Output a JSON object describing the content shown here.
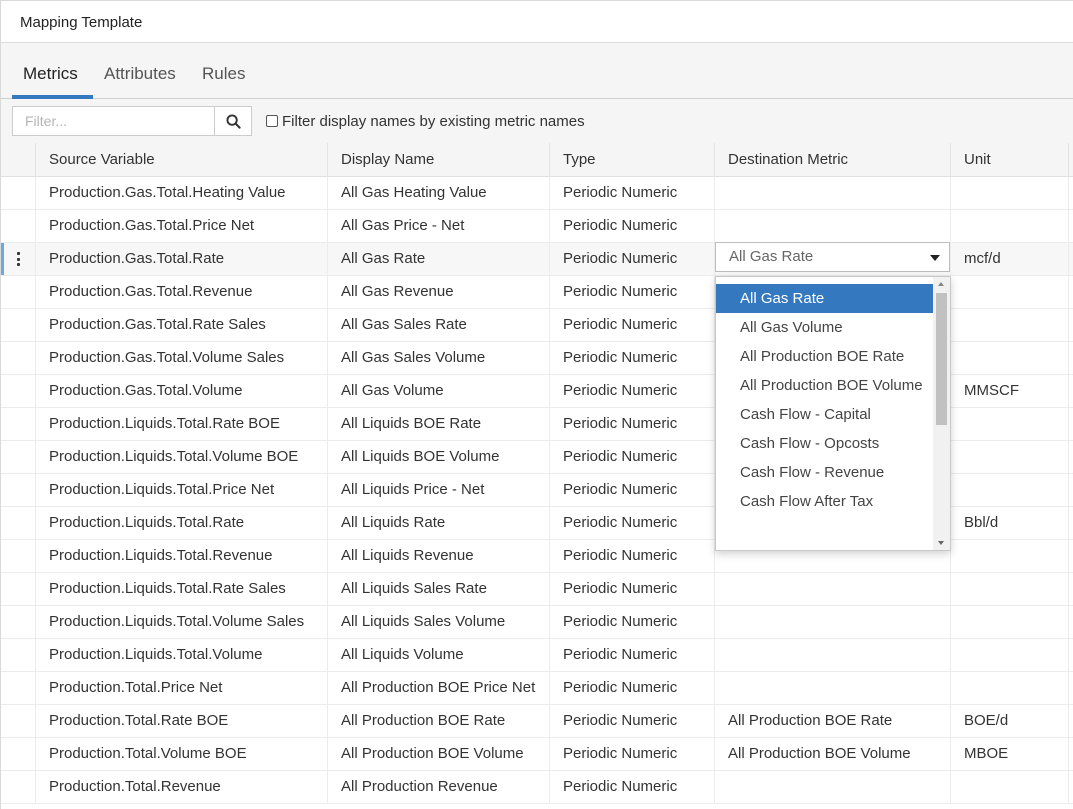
{
  "window": {
    "title": "Mapping Template"
  },
  "tabs": [
    {
      "label": "Metrics",
      "active": true
    },
    {
      "label": "Attributes",
      "active": false
    },
    {
      "label": "Rules",
      "active": false
    }
  ],
  "filter": {
    "placeholder": "Filter...",
    "value": "",
    "search_icon": "search-icon",
    "checkbox_label": "Filter display names by existing metric names",
    "checkbox_checked": false
  },
  "columns": [
    "Source Variable",
    "Display Name",
    "Type",
    "Destination Metric",
    "Unit"
  ],
  "rows": [
    {
      "source": "Production.Gas.Total.Heating Value",
      "display": "All Gas Heating Value",
      "type": "Periodic Numeric",
      "dest": "",
      "unit": ""
    },
    {
      "source": "Production.Gas.Total.Price Net",
      "display": "All Gas Price - Net",
      "type": "Periodic Numeric",
      "dest": "",
      "unit": ""
    },
    {
      "source": "Production.Gas.Total.Rate",
      "display": "All Gas Rate",
      "type": "Periodic Numeric",
      "dest": "All Gas Rate",
      "unit": "mcf/d",
      "selected": true
    },
    {
      "source": "Production.Gas.Total.Revenue",
      "display": "All Gas Revenue",
      "type": "Periodic Numeric",
      "dest": "",
      "unit": ""
    },
    {
      "source": "Production.Gas.Total.Rate Sales",
      "display": "All Gas Sales Rate",
      "type": "Periodic Numeric",
      "dest": "",
      "unit": ""
    },
    {
      "source": "Production.Gas.Total.Volume Sales",
      "display": "All Gas Sales Volume",
      "type": "Periodic Numeric",
      "dest": "",
      "unit": ""
    },
    {
      "source": "Production.Gas.Total.Volume",
      "display": "All Gas Volume",
      "type": "Periodic Numeric",
      "dest": "",
      "unit": "MMSCF"
    },
    {
      "source": "Production.Liquids.Total.Rate BOE",
      "display": "All Liquids BOE Rate",
      "type": "Periodic Numeric",
      "dest": "",
      "unit": ""
    },
    {
      "source": "Production.Liquids.Total.Volume BOE",
      "display": "All Liquids BOE Volume",
      "type": "Periodic Numeric",
      "dest": "",
      "unit": ""
    },
    {
      "source": "Production.Liquids.Total.Price Net",
      "display": "All Liquids Price - Net",
      "type": "Periodic Numeric",
      "dest": "",
      "unit": ""
    },
    {
      "source": "Production.Liquids.Total.Rate",
      "display": "All Liquids Rate",
      "type": "Periodic Numeric",
      "dest": "",
      "unit": "Bbl/d"
    },
    {
      "source": "Production.Liquids.Total.Revenue",
      "display": "All Liquids Revenue",
      "type": "Periodic Numeric",
      "dest": "",
      "unit": ""
    },
    {
      "source": "Production.Liquids.Total.Rate Sales",
      "display": "All Liquids Sales Rate",
      "type": "Periodic Numeric",
      "dest": "",
      "unit": ""
    },
    {
      "source": "Production.Liquids.Total.Volume Sales",
      "display": "All Liquids Sales Volume",
      "type": "Periodic Numeric",
      "dest": "",
      "unit": ""
    },
    {
      "source": "Production.Liquids.Total.Volume",
      "display": "All Liquids Volume",
      "type": "Periodic Numeric",
      "dest": "",
      "unit": ""
    },
    {
      "source": "Production.Total.Price Net",
      "display": "All Production BOE Price Net",
      "type": "Periodic Numeric",
      "dest": "",
      "unit": ""
    },
    {
      "source": "Production.Total.Rate BOE",
      "display": "All Production BOE Rate",
      "type": "Periodic Numeric",
      "dest": "All Production BOE Rate",
      "unit": "BOE/d"
    },
    {
      "source": "Production.Total.Volume BOE",
      "display": "All Production BOE Volume",
      "type": "Periodic Numeric",
      "dest": "All Production BOE Volume",
      "unit": "MBOE"
    },
    {
      "source": "Production.Total.Revenue",
      "display": "All Production Revenue",
      "type": "Periodic Numeric",
      "dest": "",
      "unit": ""
    }
  ],
  "dropdown": {
    "selected_value": "All Gas Rate",
    "options": [
      "All Gas Rate",
      "All Gas Volume",
      "All Production BOE Rate",
      "All Production BOE Volume",
      "Cash Flow - Capital",
      "Cash Flow - Opcosts",
      "Cash Flow - Revenue",
      "Cash Flow After Tax"
    ],
    "highlighted_index": 0
  },
  "colors": {
    "accent": "#3478c0",
    "selected_marker": "#6aa8e0"
  }
}
